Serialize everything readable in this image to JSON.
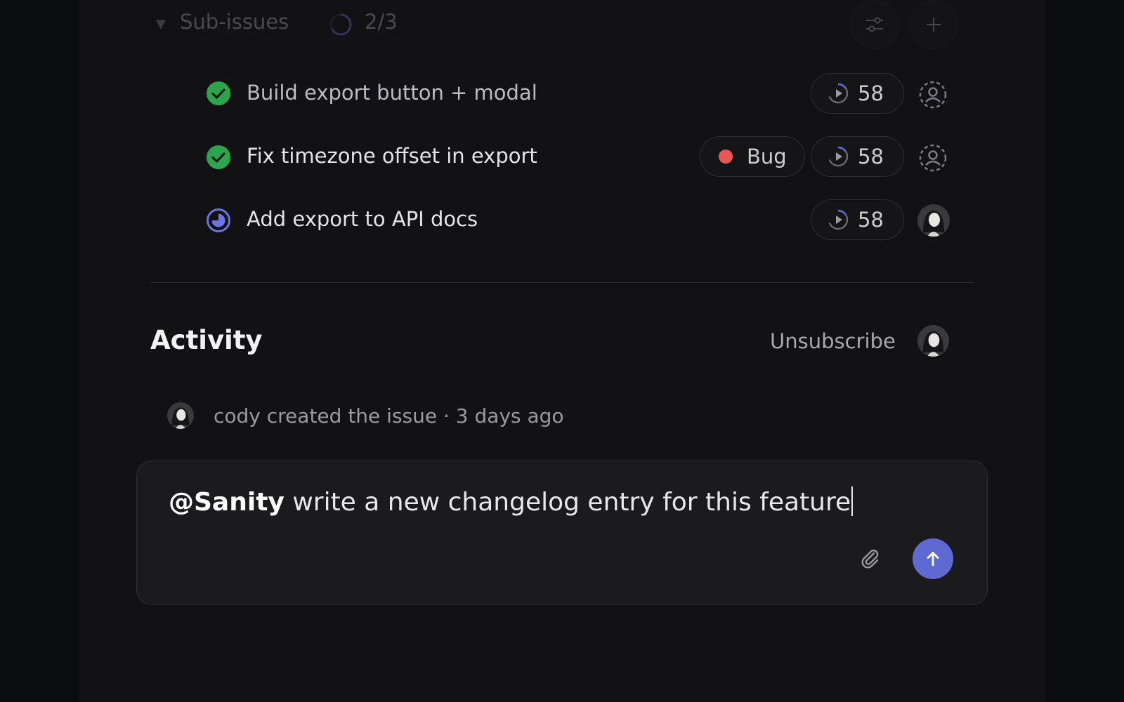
{
  "sub_issues": {
    "title": "Sub-issues",
    "progress_text": "2/3",
    "progress_fraction": 0.667,
    "items": [
      {
        "title": "Build export button + modal",
        "status": "done",
        "estimate": "58",
        "label": null,
        "assignee": "unassigned"
      },
      {
        "title": "Fix timezone offset in export",
        "status": "done",
        "estimate": "58",
        "label": "Bug",
        "assignee": "unassigned"
      },
      {
        "title": "Add export to API docs",
        "status": "in-progress",
        "estimate": "58",
        "label": null,
        "assignee": "user-avatar"
      }
    ]
  },
  "activity": {
    "title": "Activity",
    "unsubscribe_label": "Unsubscribe",
    "events": [
      {
        "text": "cody created the issue · 3 days ago"
      }
    ]
  },
  "composer": {
    "mention": "@Sanity",
    "text": " write a new changelog entry for this feature"
  },
  "colors": {
    "accent": "#5e6ad2",
    "done": "#2da44e",
    "bug": "#eb5757",
    "background": "#121214"
  },
  "icons": [
    "chevron-down-icon",
    "filter-icon",
    "plus-icon",
    "check-circle-icon",
    "in-progress-icon",
    "estimate-icon",
    "unassigned-icon",
    "attach-icon",
    "arrow-up-icon"
  ]
}
